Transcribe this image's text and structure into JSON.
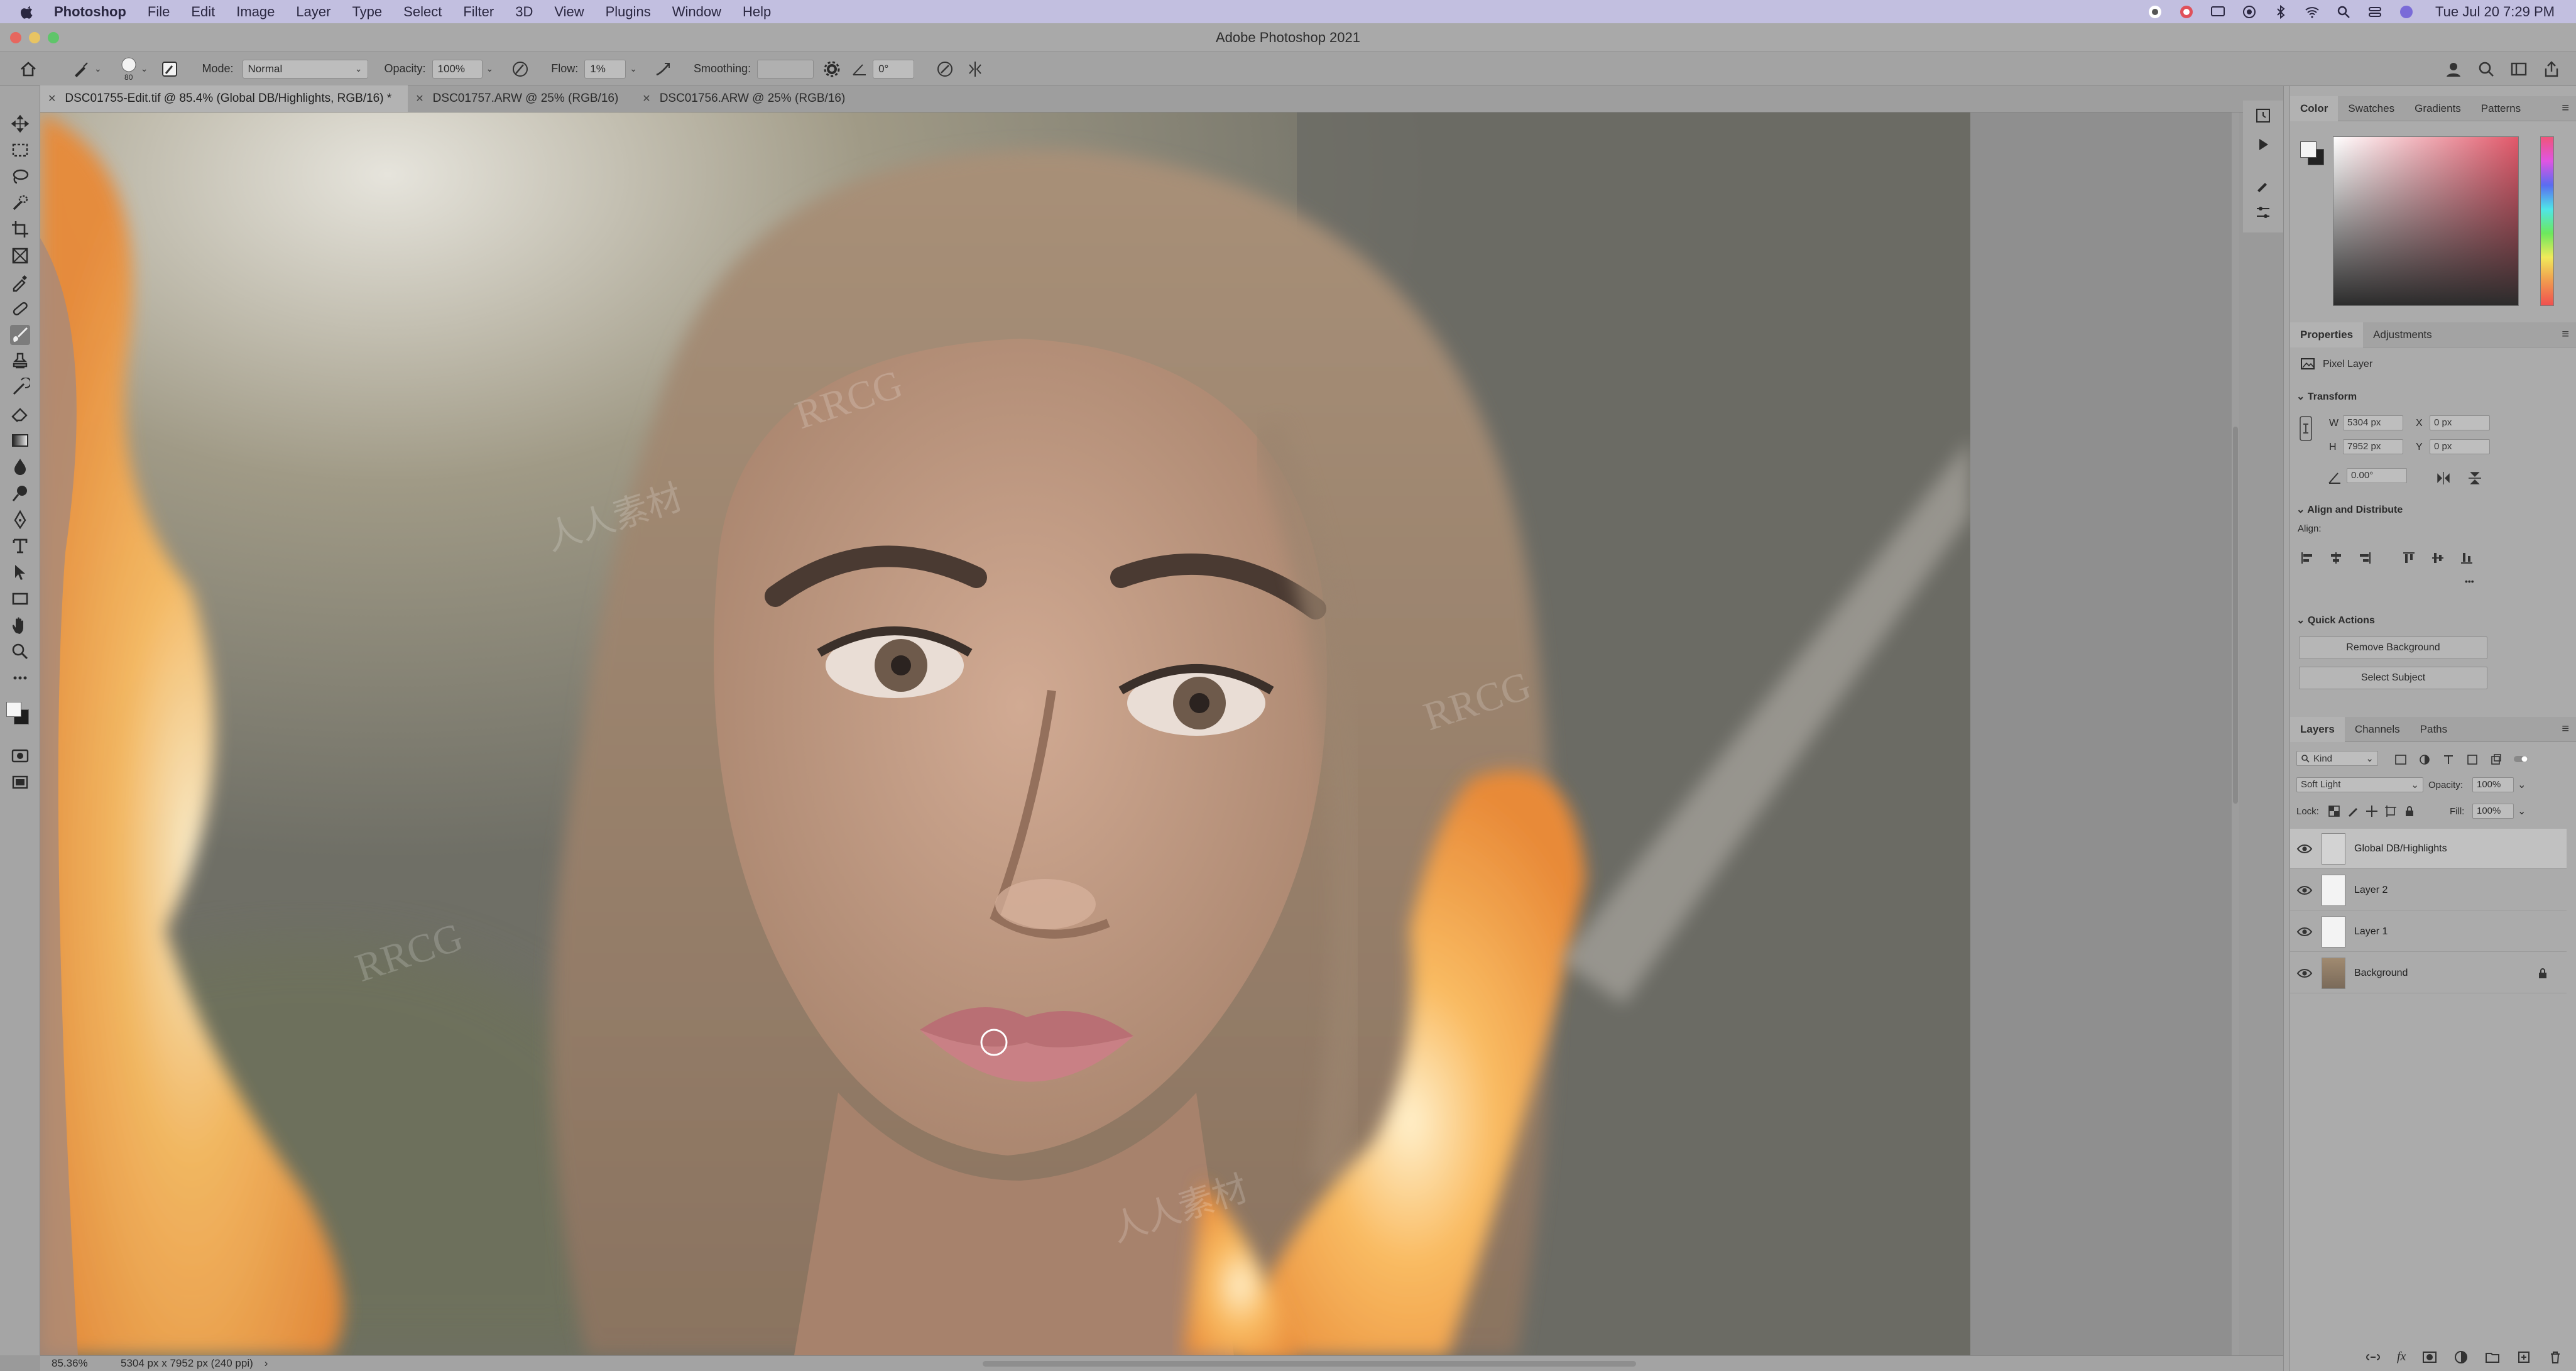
{
  "menubar": {
    "app_name": "Photoshop",
    "items": [
      "File",
      "Edit",
      "Image",
      "Layer",
      "Type",
      "Select",
      "Filter",
      "3D",
      "View",
      "Plugins",
      "Window",
      "Help"
    ],
    "clock": "Tue Jul 20  7:29 PM"
  },
  "window": {
    "title": "Adobe Photoshop 2021"
  },
  "options": {
    "brush_size": "80",
    "mode_label": "Mode:",
    "mode_value": "Normal",
    "opacity_label": "Opacity:",
    "opacity_value": "100%",
    "flow_label": "Flow:",
    "flow_value": "1%",
    "smoothing_label": "Smoothing:",
    "smoothing_value": "",
    "angle_value": "0°"
  },
  "tabs": [
    {
      "label": "DSC01755-Edit.tif @ 85.4% (Global DB/Highlights, RGB/16) *",
      "active": true
    },
    {
      "label": "DSC01757.ARW @ 25% (RGB/16)",
      "active": false
    },
    {
      "label": "DSC01756.ARW @ 25% (RGB/16)",
      "active": false
    }
  ],
  "status": {
    "zoom": "85.36%",
    "doc_info": "5304 px x 7952 px (240 ppi)"
  },
  "color_panel": {
    "tabs": [
      "Color",
      "Swatches",
      "Gradients",
      "Patterns"
    ],
    "foreground": "#f4f4f4",
    "background": "#222222"
  },
  "properties_panel": {
    "tabs": [
      "Properties",
      "Adjustments"
    ],
    "layer_type": "Pixel Layer",
    "transform_head": "Transform",
    "w_label": "W",
    "w_value": "5304 px",
    "h_label": "H",
    "h_value": "7952 px",
    "x_label": "X",
    "x_value": "0 px",
    "y_label": "Y",
    "y_value": "0 px",
    "angle_value": "0.00°",
    "align_head": "Align and Distribute",
    "align_label": "Align:",
    "more": "•••",
    "quick_head": "Quick Actions",
    "remove_bg": "Remove Background",
    "select_subject": "Select Subject"
  },
  "layers_panel": {
    "tabs": [
      "Layers",
      "Channels",
      "Paths"
    ],
    "filter_kind": "Kind",
    "blend_mode": "Soft Light",
    "opacity_label": "Opacity:",
    "opacity_value": "100%",
    "lock_label": "Lock:",
    "fill_label": "Fill:",
    "fill_value": "100%",
    "layers": [
      {
        "name": "Global DB/Highlights",
        "selected": true
      },
      {
        "name": "Layer 2",
        "selected": false
      },
      {
        "name": "Layer 1",
        "selected": false
      },
      {
        "name": "Background",
        "selected": false,
        "locked": true
      }
    ]
  },
  "watermark": {
    "brand": "RRCG",
    "sub": "人人素材"
  }
}
